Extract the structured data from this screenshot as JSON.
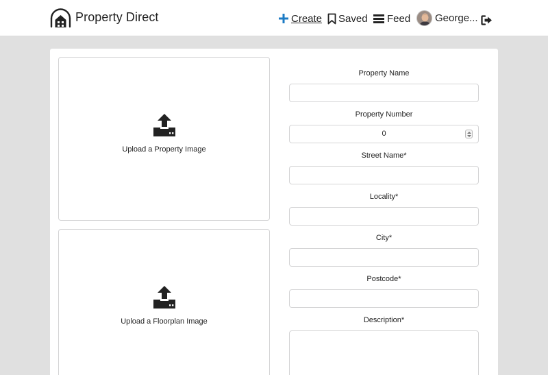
{
  "header": {
    "brand": "Property Direct",
    "nav": {
      "create": "Create",
      "saved": "Saved",
      "feed": "Feed",
      "user": "George..."
    },
    "icons": [
      "house-logo-icon",
      "plus-icon",
      "bookmark-icon",
      "menu-icon",
      "avatar",
      "logout-icon"
    ],
    "accent_color": "#1c7bc4"
  },
  "uploads": {
    "property_image": "Upload a Property Image",
    "floorplan_image": "Upload a Floorplan Image"
  },
  "form": {
    "property_name": {
      "label": "Property Name",
      "value": ""
    },
    "property_number": {
      "label": "Property Number",
      "value": "0"
    },
    "street_name": {
      "label": "Street Name*",
      "value": ""
    },
    "locality": {
      "label": "Locality*",
      "value": ""
    },
    "city": {
      "label": "City*",
      "value": ""
    },
    "postcode": {
      "label": "Postcode*",
      "value": ""
    },
    "description": {
      "label": "Description*",
      "value": ""
    }
  }
}
